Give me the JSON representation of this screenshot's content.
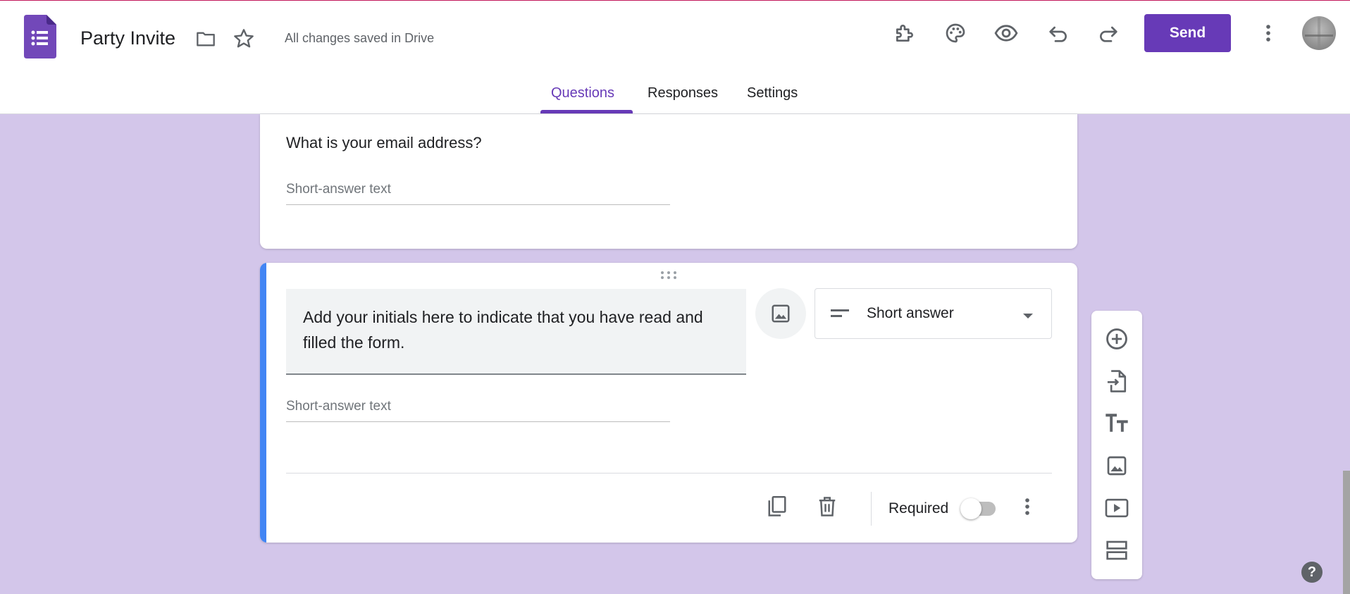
{
  "header": {
    "title": "Party Invite",
    "save_status": "All changes saved in Drive",
    "send_label": "Send",
    "icons": [
      "forms-logo-icon",
      "folder-icon",
      "star-icon",
      "addons-icon",
      "palette-icon",
      "preview-eye-icon",
      "undo-icon",
      "redo-icon",
      "more-vert-icon",
      "avatar"
    ]
  },
  "tabs": [
    {
      "label": "Questions",
      "active": true
    },
    {
      "label": "Responses",
      "active": false
    },
    {
      "label": "Settings",
      "active": false
    }
  ],
  "questions": [
    {
      "title": "What is your email address?",
      "answer_placeholder": "Short-answer text"
    },
    {
      "title": "Add your initials here to indicate that you have read and filled the form.",
      "answer_placeholder": "Short-answer text",
      "type": "Short answer",
      "required_label": "Required",
      "required": false
    }
  ],
  "sidebar_tools": [
    "add-question-icon",
    "import-questions-icon",
    "add-title-icon",
    "add-image-icon",
    "add-video-icon",
    "add-section-icon"
  ],
  "colors": {
    "accent": "#673ab7",
    "background": "#d3c6ea",
    "focus_bar": "#4285f4"
  }
}
